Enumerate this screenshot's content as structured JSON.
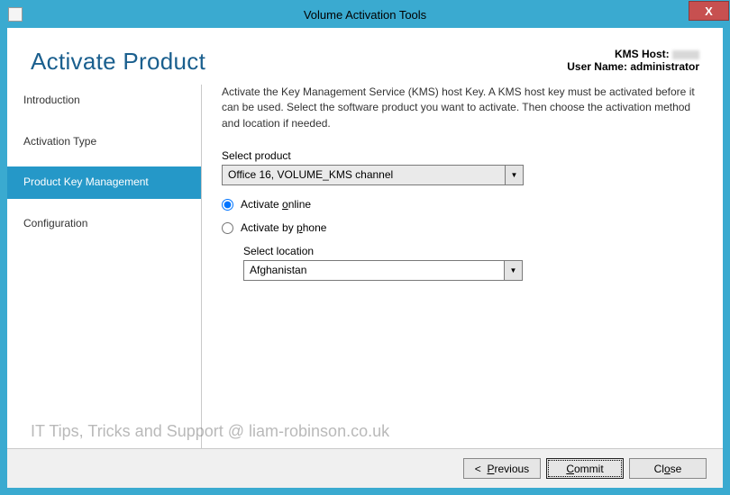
{
  "window": {
    "title": "Volume Activation Tools",
    "close": "X"
  },
  "header": {
    "heading": "Activate Product",
    "kms_host_label": "KMS Host:",
    "kms_host_value": "",
    "username_label": "User Name:",
    "username_value": "administrator"
  },
  "sidebar": {
    "items": [
      {
        "label": "Introduction"
      },
      {
        "label": "Activation Type"
      },
      {
        "label": "Product Key Management"
      },
      {
        "label": "Configuration"
      }
    ]
  },
  "main": {
    "instruction": "Activate the Key Management Service (KMS) host Key. A KMS host key must be activated before it can be used. Select the software product you want to activate. Then choose the activation method and location if needed.",
    "select_product_label": "Select product",
    "select_product_value": "Office 16, VOLUME_KMS channel",
    "activate_online_label": "Activate online",
    "activate_by_phone_label": "Activate by phone",
    "select_location_label": "Select location",
    "select_location_value": "Afghanistan"
  },
  "buttons": {
    "previous": "< Previous",
    "commit": "Commit",
    "close": "Close"
  },
  "watermark": "IT Tips, Tricks and Support @ liam-robinson.co.uk"
}
